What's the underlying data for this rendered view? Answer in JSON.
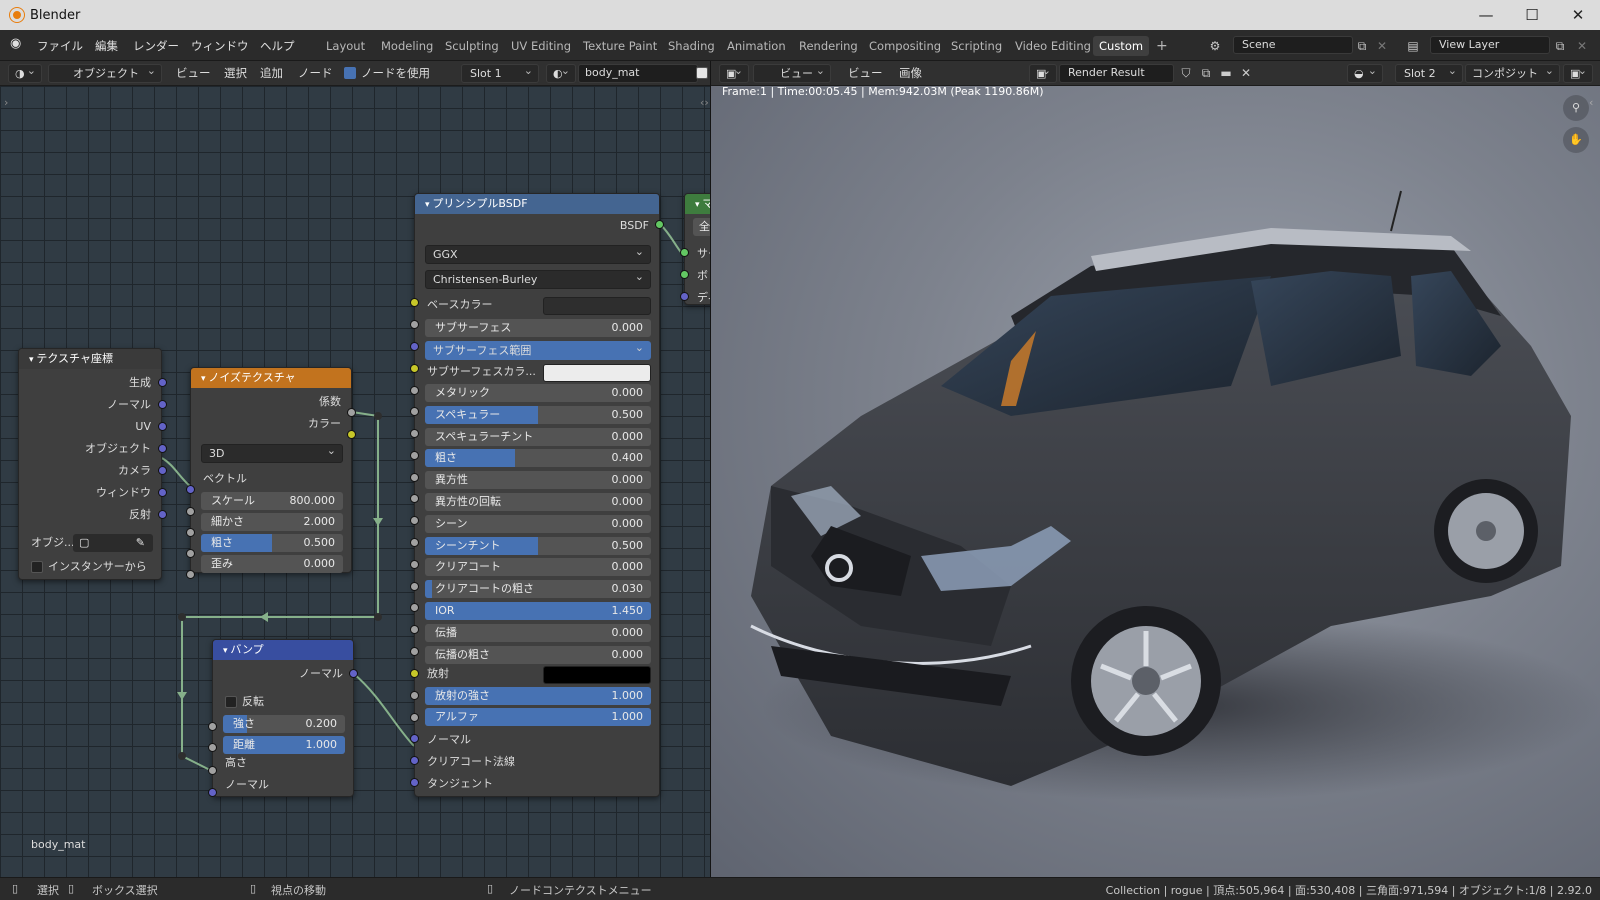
{
  "window": {
    "title": "Blender",
    "minimize": "—",
    "maximize": "☐",
    "close": "✕"
  },
  "menus": [
    "ファイル",
    "編集",
    "レンダー",
    "ウィンドウ",
    "ヘルプ"
  ],
  "workspaces": [
    {
      "label": "Layout"
    },
    {
      "label": "Modeling"
    },
    {
      "label": "Sculpting"
    },
    {
      "label": "UV Editing"
    },
    {
      "label": "Texture Paint"
    },
    {
      "label": "Shading"
    },
    {
      "label": "Animation"
    },
    {
      "label": "Rendering"
    },
    {
      "label": "Compositing"
    },
    {
      "label": "Scripting"
    },
    {
      "label": "Video Editing"
    },
    {
      "label": "Custom",
      "active": true
    }
  ],
  "add_workspace": "+",
  "scene": {
    "name": "Scene"
  },
  "view_layer": {
    "name": "View Layer"
  },
  "node_header": {
    "object_mode": "オブジェクト",
    "view": "ビュー",
    "select": "選択",
    "add": "追加",
    "node": "ノード",
    "use_nodes": "ノードを使用",
    "slot": "Slot 1",
    "material": "body_mat"
  },
  "image_header": {
    "view1": "ビュー",
    "view2": "ビュー",
    "image": "画像",
    "image_name": "Render Result",
    "slot": "Slot 2",
    "composite": "コンポジット"
  },
  "render_info": "Frame:1 | Time:00:05.45 | Mem:942.03M (Peak 1190.86M)",
  "editor_label": "body_mat",
  "nodes": {
    "texcoord": {
      "title": "テクスチャ座標",
      "outputs": [
        "生成",
        "ノーマル",
        "UV",
        "オブジェクト",
        "カメラ",
        "ウィンドウ",
        "反射"
      ],
      "object_label": "オブジ...",
      "from_instancer": "インスタンサーから"
    },
    "noise": {
      "title": "ノイズテクスチャ",
      "out_fac": "係数",
      "out_color": "カラー",
      "dimension": "3D",
      "in_vector": "ベクトル",
      "sliders": [
        {
          "label": "スケール",
          "value": "800.000",
          "fraction": 0
        },
        {
          "label": "細かさ",
          "value": "2.000",
          "fraction": 0
        },
        {
          "label": "粗さ",
          "value": "0.500",
          "fraction": 0.5
        },
        {
          "label": "歪み",
          "value": "0.000",
          "fraction": 0
        }
      ]
    },
    "bump": {
      "title": "バンプ",
      "out_normal": "ノーマル",
      "invert": "反転",
      "sliders": [
        {
          "label": "強さ",
          "value": "0.200",
          "fraction": 0.2
        },
        {
          "label": "距離",
          "value": "1.000",
          "fraction": 1
        }
      ],
      "in_height": "高さ",
      "in_normal": "ノーマル"
    },
    "bsdf": {
      "title": "プリンシプルBSDF",
      "out": "BSDF",
      "distribution": "GGX",
      "subsurface_method": "Christensen-Burley",
      "base_color": "ベースカラー",
      "subsurface": {
        "label": "サブサーフェス",
        "value": "0.000",
        "fraction": 0
      },
      "subsurface_radius": "サブサーフェス範囲",
      "subsurface_color": "サブサーフェスカラ...",
      "sliders": [
        {
          "label": "メタリック",
          "value": "0.000",
          "fraction": 0
        },
        {
          "label": "スペキュラー",
          "value": "0.500",
          "fraction": 0.5
        },
        {
          "label": "スペキュラーチント",
          "value": "0.000",
          "fraction": 0
        },
        {
          "label": "粗さ",
          "value": "0.400",
          "fraction": 0.4
        },
        {
          "label": "異方性",
          "value": "0.000",
          "fraction": 0
        },
        {
          "label": "異方性の回転",
          "value": "0.000",
          "fraction": 0
        },
        {
          "label": "シーン",
          "value": "0.000",
          "fraction": 0
        },
        {
          "label": "シーンチント",
          "value": "0.500",
          "fraction": 0.5
        },
        {
          "label": "クリアコート",
          "value": "0.000",
          "fraction": 0
        },
        {
          "label": "クリアコートの粗さ",
          "value": "0.030",
          "fraction": 0.03
        },
        {
          "label": "IOR",
          "value": "1.450",
          "fraction": 1
        },
        {
          "label": "伝播",
          "value": "0.000",
          "fraction": 0
        },
        {
          "label": "伝播の粗さ",
          "value": "0.000",
          "fraction": 0
        }
      ],
      "emission": "放射",
      "sliders2": [
        {
          "label": "放射の強さ",
          "value": "1.000",
          "fraction": 1
        },
        {
          "label": "アルファ",
          "value": "1.000",
          "fraction": 1
        }
      ],
      "inputs_end": [
        "ノーマル",
        "クリアコート法線",
        "タンジェント"
      ]
    },
    "output": {
      "title": "マ",
      "rows": [
        "サー",
        "ボリ",
        "ディ"
      ],
      "target": "全"
    }
  },
  "status": {
    "select": "選択",
    "box_select": "ボックス選択",
    "pan_view": "視点の移動",
    "context_menu": "ノードコンテクストメニュー",
    "stats": "Collection | rogue | 頂点:505,964 | 面:530,408 | 三角面:971,594 | オブジェクト:1/8 | 2.92.0"
  },
  "colors": {
    "accent": "#4772b3",
    "noise_header": "#c2731e",
    "bsdf_header": "#446591",
    "bump_header": "#384ea0",
    "texcoord_header": "#3a3a3a",
    "output_header": "#3e7c3e"
  }
}
